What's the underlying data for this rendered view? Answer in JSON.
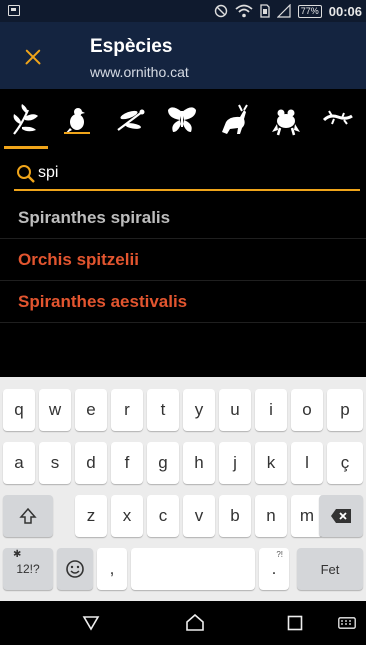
{
  "status_bar": {
    "battery": "77%",
    "time": "00:06"
  },
  "app_bar": {
    "title": "Espècies",
    "subtitle": "www.ornitho.cat"
  },
  "colors": {
    "accent": "#f0a51a",
    "app_bar_bg": "#142440",
    "result_highlight": "#e2552f",
    "result_normal": "#bdbdbd"
  },
  "category_tabs": [
    {
      "icon": "orchid-icon",
      "selected": true
    },
    {
      "icon": "bird-icon",
      "selected": false
    },
    {
      "icon": "dragonfly-icon",
      "selected": false
    },
    {
      "icon": "butterfly-icon",
      "selected": false
    },
    {
      "icon": "mammal-icon",
      "selected": false
    },
    {
      "icon": "frog-icon",
      "selected": false
    },
    {
      "icon": "lizard-icon",
      "selected": false
    }
  ],
  "search": {
    "value": "spi",
    "icon": "search-icon"
  },
  "results": [
    {
      "name": "Spiranthes spiralis",
      "highlight": false
    },
    {
      "name": "Orchis spitzelii",
      "highlight": true
    },
    {
      "name": "Spiranthes aestivalis",
      "highlight": true
    }
  ],
  "keyboard": {
    "row1": [
      "q",
      "w",
      "e",
      "r",
      "t",
      "y",
      "u",
      "i",
      "o",
      "p"
    ],
    "row2": [
      "a",
      "s",
      "d",
      "f",
      "g",
      "h",
      "j",
      "k",
      "l",
      "ç"
    ],
    "row3": [
      "z",
      "x",
      "c",
      "v",
      "b",
      "n",
      "m"
    ],
    "symbols_key": "12!?",
    "comma_key": ",",
    "period_key": ".",
    "period_sup": "?!",
    "enter_key": "Fet"
  }
}
